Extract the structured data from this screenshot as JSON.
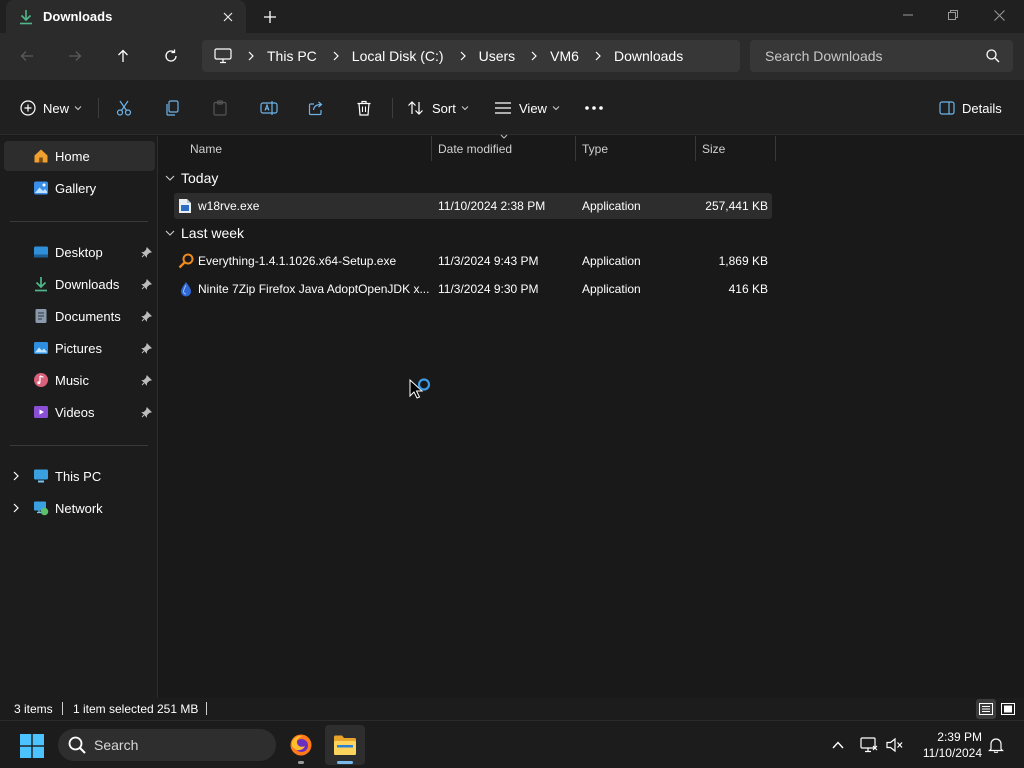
{
  "window": {
    "tab_title": "Downloads",
    "tab_icon": "download-arrow-icon",
    "new_tab_label": "+",
    "controls": [
      "minimize-icon",
      "maximize-icon",
      "close-icon"
    ]
  },
  "nav": {
    "buttons": [
      "back-arrow-icon",
      "forward-arrow-icon",
      "up-arrow-icon",
      "refresh-icon"
    ],
    "breadcrumb": [
      "This PC",
      "Local Disk (C:)",
      "Users",
      "VM6",
      "Downloads"
    ],
    "search_placeholder": "Search Downloads"
  },
  "commandbar": {
    "new_label": "New",
    "sort_label": "Sort",
    "view_label": "View",
    "details_label": "Details",
    "icons": [
      "cut-icon",
      "copy-icon",
      "paste-icon",
      "rename-icon",
      "share-icon",
      "delete-icon",
      "more-icon"
    ]
  },
  "sidebar": {
    "top": [
      {
        "label": "Home",
        "icon": "home-icon",
        "selected": true
      },
      {
        "label": "Gallery",
        "icon": "gallery-icon"
      }
    ],
    "pinned": [
      {
        "label": "Desktop",
        "icon": "desktop-icon"
      },
      {
        "label": "Downloads",
        "icon": "download-icon"
      },
      {
        "label": "Documents",
        "icon": "documents-icon"
      },
      {
        "label": "Pictures",
        "icon": "pictures-icon"
      },
      {
        "label": "Music",
        "icon": "music-icon"
      },
      {
        "label": "Videos",
        "icon": "videos-icon"
      }
    ],
    "bottom": [
      {
        "label": "This PC",
        "icon": "this-pc-icon"
      },
      {
        "label": "Network",
        "icon": "network-icon"
      }
    ]
  },
  "columns": {
    "name": "Name",
    "date": "Date modified",
    "type": "Type",
    "size": "Size"
  },
  "groups": [
    {
      "label": "Today",
      "files": [
        {
          "name": "w18rve.exe",
          "date": "11/10/2024 2:38 PM",
          "type": "Application",
          "size": "257,441 KB",
          "selected": true,
          "icon": "exe-file-icon"
        }
      ]
    },
    {
      "label": "Last week",
      "files": [
        {
          "name": "Everything-1.4.1.1026.x64-Setup.exe",
          "date": "11/3/2024 9:43 PM",
          "type": "Application",
          "size": "1,869 KB",
          "icon": "everything-app-icon"
        },
        {
          "name": "Ninite 7Zip Firefox Java AdoptOpenJDK x...",
          "date": "11/3/2024 9:30 PM",
          "type": "Application",
          "size": "416 KB",
          "icon": "ninite-app-icon"
        }
      ]
    }
  ],
  "status": {
    "items_count": "3 items",
    "selection": "1 item selected",
    "selection_size": "251 MB"
  },
  "taskbar": {
    "search_label": "Search",
    "time": "2:39 PM",
    "date": "11/10/2024",
    "apps": [
      "firefox-icon",
      "file-explorer-icon"
    ]
  },
  "colors": {
    "accent": "#76b9ed",
    "window_bg": "#191919",
    "selected_row": "#2d2d2d"
  }
}
